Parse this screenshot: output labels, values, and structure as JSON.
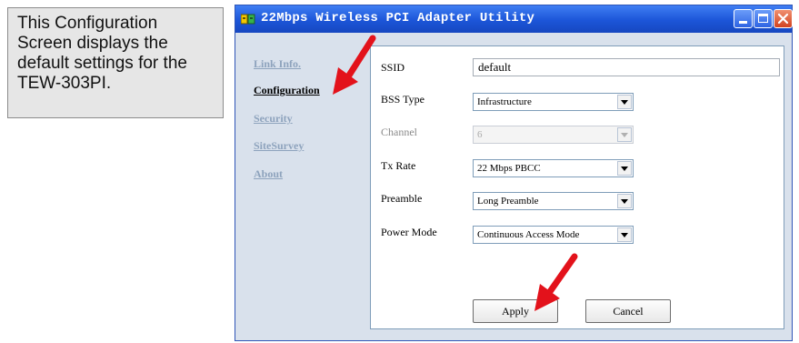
{
  "callout": {
    "text": "This Configuration Screen displays the default settings for the TEW-303PI."
  },
  "window": {
    "title": "22Mbps Wireless PCI Adapter Utility",
    "app_icon": "adapter-app-icon"
  },
  "sidebar": {
    "items": [
      {
        "label": "Link Info.",
        "active": false
      },
      {
        "label": "Configuration",
        "active": true
      },
      {
        "label": "Security",
        "active": false
      },
      {
        "label": "SiteSurvey",
        "active": false
      },
      {
        "label": "About",
        "active": false
      }
    ]
  },
  "config": {
    "ssid_label": "SSID",
    "ssid_value": "default",
    "bss_type_label": "BSS Type",
    "bss_type_value": "Infrastructure",
    "channel_label": "Channel",
    "channel_value": "6",
    "tx_rate_label": "Tx Rate",
    "tx_rate_value": "22 Mbps PBCC",
    "preamble_label": "Preamble",
    "preamble_value": "Long Preamble",
    "power_mode_label": "Power Mode",
    "power_mode_value": "Continuous Access Mode"
  },
  "buttons": {
    "apply": "Apply",
    "cancel": "Cancel"
  },
  "colors": {
    "titlebar": "#245edb",
    "window_bg": "#d9e1ec",
    "annotation_arrow": "#e3121b"
  }
}
